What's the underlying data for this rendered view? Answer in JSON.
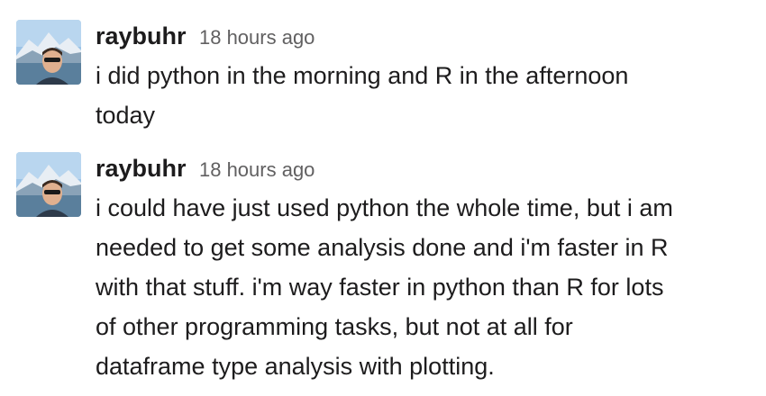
{
  "messages": [
    {
      "author": "raybuhr",
      "timestamp": "18 hours ago",
      "lines": [
        "i did python in the morning and R in the afternoon",
        "today"
      ]
    },
    {
      "author": "raybuhr",
      "timestamp": "18 hours ago",
      "lines": [
        "i could have just used python the whole time, but i am",
        "needed to get some analysis done and i'm faster in R",
        "with that stuff. i'm way faster in python than R for lots",
        "of other programming tasks, but not at all for",
        "dataframe type analysis with plotting."
      ]
    }
  ],
  "colors": {
    "text": "#1d1c1d",
    "timestamp": "#616061"
  }
}
